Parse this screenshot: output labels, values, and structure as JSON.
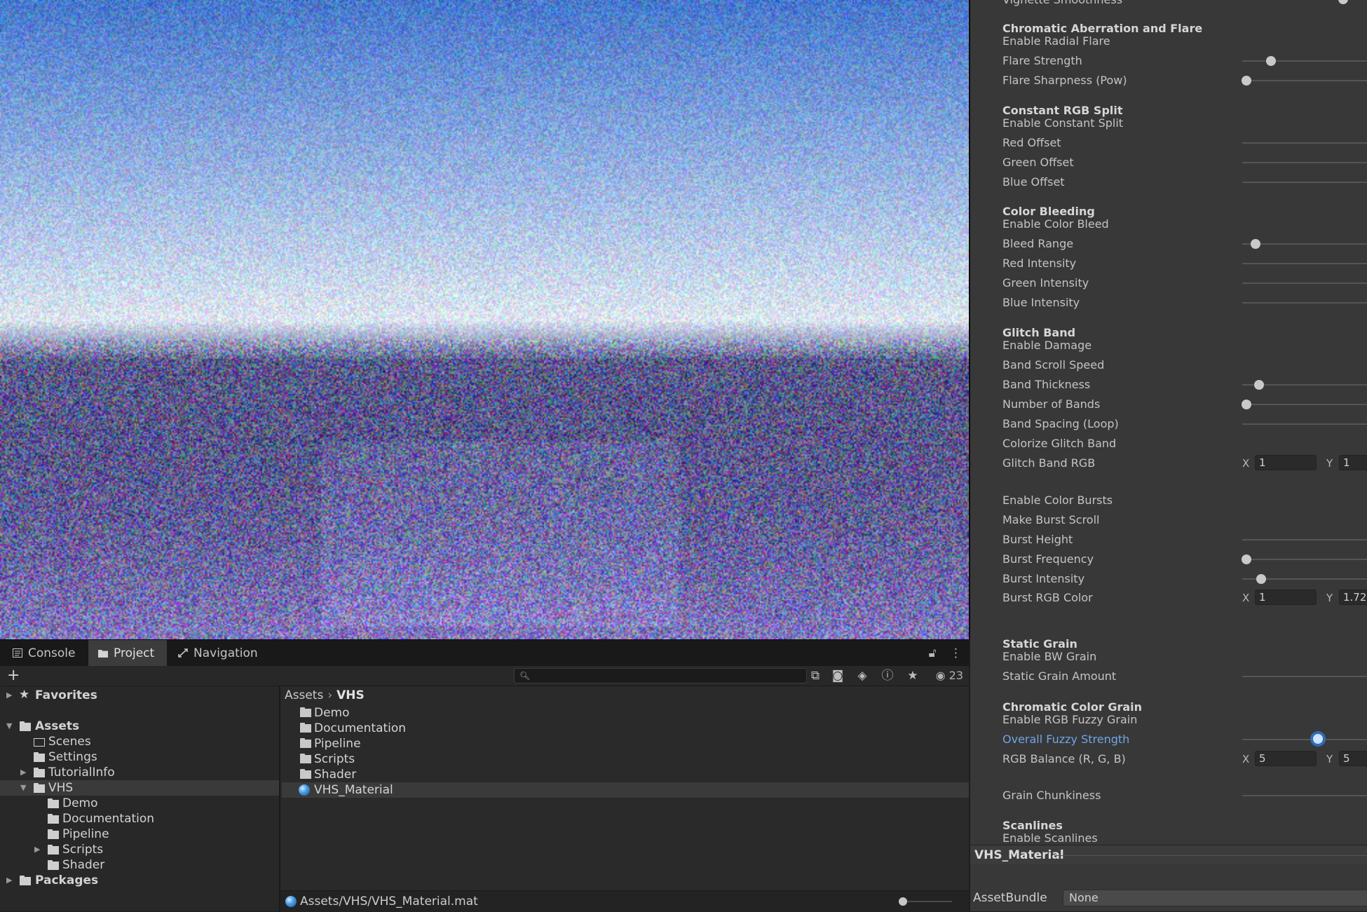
{
  "bottom_tabs": [
    {
      "label": "Console",
      "icon": "console-icon"
    },
    {
      "label": "Project",
      "icon": "folder-icon"
    },
    {
      "label": "Navigation",
      "icon": "navigation-icon"
    }
  ],
  "toolbar": {
    "add_label": "+",
    "search_placeholder": "",
    "hidden_count": "23"
  },
  "tree": [
    {
      "label": "Favorites"
    },
    {
      "label": "Assets"
    },
    {
      "label": "Scenes"
    },
    {
      "label": "Settings"
    },
    {
      "label": "TutorialInfo"
    },
    {
      "label": "VHS"
    },
    {
      "label": "Demo"
    },
    {
      "label": "Documentation"
    },
    {
      "label": "Pipeline"
    },
    {
      "label": "Scripts"
    },
    {
      "label": "Shader"
    },
    {
      "label": "Packages"
    }
  ],
  "breadcrumb": {
    "root": "Assets",
    "current": "VHS"
  },
  "assets": [
    {
      "label": "Demo"
    },
    {
      "label": "Documentation"
    },
    {
      "label": "Pipeline"
    },
    {
      "label": "Scripts"
    },
    {
      "label": "Shader"
    },
    {
      "label": "VHS_Material"
    }
  ],
  "status_path": "Assets/VHS/VHS_Material.mat",
  "inspector": {
    "labels": [
      "Vignette Smoothness",
      "Chromatic Aberration and Flare",
      "Enable Radial Flare",
      "Flare Strength",
      "Flare Sharpness (Pow)",
      "Constant RGB Split",
      "Enable Constant Split",
      "Red Offset",
      "Green Offset",
      "Blue Offset",
      "Color Bleeding",
      "Enable Color Bleed",
      "Bleed Range",
      "Red Intensity",
      "Green Intensity",
      "Blue Intensity",
      "Glitch Band",
      "Enable Damage",
      "Band Scroll Speed",
      "Band Thickness",
      "Number of Bands",
      "Band Spacing (Loop)",
      "Colorize Glitch Band",
      "Glitch Band RGB",
      "Enable Color Bursts",
      "Make Burst Scroll",
      "Burst Height",
      "Burst Frequency",
      "Burst Intensity",
      "Burst RGB Color",
      "Static Grain",
      "Enable BW Grain",
      "Static Grain Amount",
      "Chromatic Color Grain",
      "Enable RGB Fuzzy Grain",
      "Overall Fuzzy Strength",
      "RGB Balance (R, G, B)",
      "Grain Chunkiness",
      "Scanlines",
      "Enable Scanlines"
    ],
    "vectors": {
      "glitch_band_rgb": {
        "x_label": "X",
        "x": "1",
        "y_label": "Y",
        "y": "1"
      },
      "burst_rgb_color": {
        "x_label": "X",
        "x": "1",
        "y_label": "Y",
        "y": "1.72"
      },
      "rgb_balance": {
        "x_label": "X",
        "x": "5",
        "y_label": "Y",
        "y": "5"
      }
    },
    "footer_title": "VHS_Material",
    "asset_bundle_label": "AssetBundle",
    "asset_bundle_value": "None"
  }
}
